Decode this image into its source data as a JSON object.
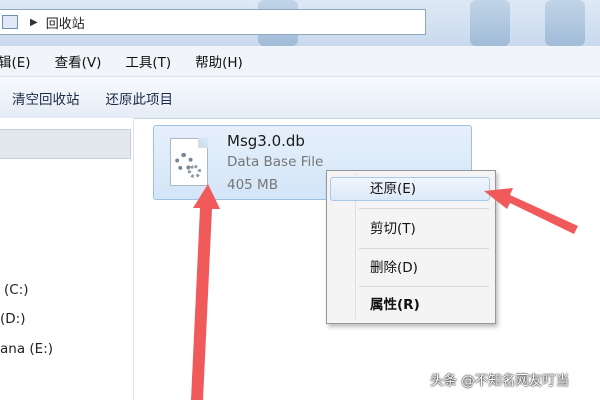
{
  "address_bar": {
    "icon": "recycle-bin-icon",
    "separator": "▶",
    "location": "回收站"
  },
  "menu": [
    "辑(E)",
    "查看(V)",
    "工具(T)",
    "帮助(H)"
  ],
  "toolbar": {
    "empty_label": "清空回收站",
    "restore_all_label": "还原此项目"
  },
  "nav": {
    "drive_c": "(C:)",
    "drive_d": "(D:)",
    "drive_e": "ana (E:)"
  },
  "file": {
    "name": "Msg3.0.db",
    "type": "Data Base File",
    "size": "405 MB",
    "icon": "database-file-icon"
  },
  "context_menu": {
    "restore": "还原(E)",
    "cut": "剪切(T)",
    "delete": "删除(D)",
    "properties": "属性(R)"
  },
  "annotation_color": "#f05a5a",
  "watermark": "头条 @不知名网友叮当"
}
